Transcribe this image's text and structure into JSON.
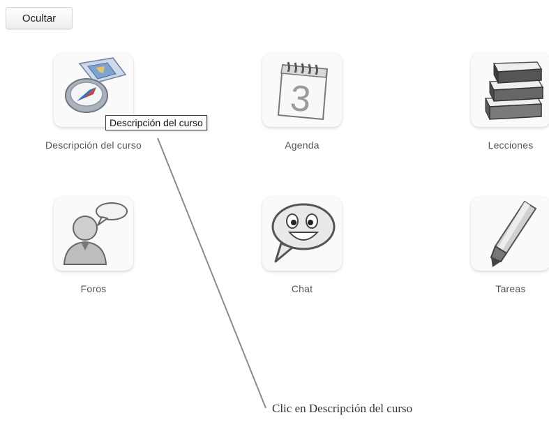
{
  "toolbar": {
    "hide_label": "Ocultar"
  },
  "tools": [
    {
      "label": "Descripción del curso",
      "icon": "course-description-icon"
    },
    {
      "label": "Agenda",
      "icon": "calendar-icon",
      "calendar_day": "3"
    },
    {
      "label": "Lecciones",
      "icon": "books-icon"
    },
    {
      "label": "Foros",
      "icon": "forum-icon"
    },
    {
      "label": "Chat",
      "icon": "chat-icon"
    },
    {
      "label": "Tareas",
      "icon": "pen-icon"
    }
  ],
  "tooltip": {
    "text": "Descripción del curso"
  },
  "annotation": {
    "text": "Clic en Descripción del curso"
  }
}
